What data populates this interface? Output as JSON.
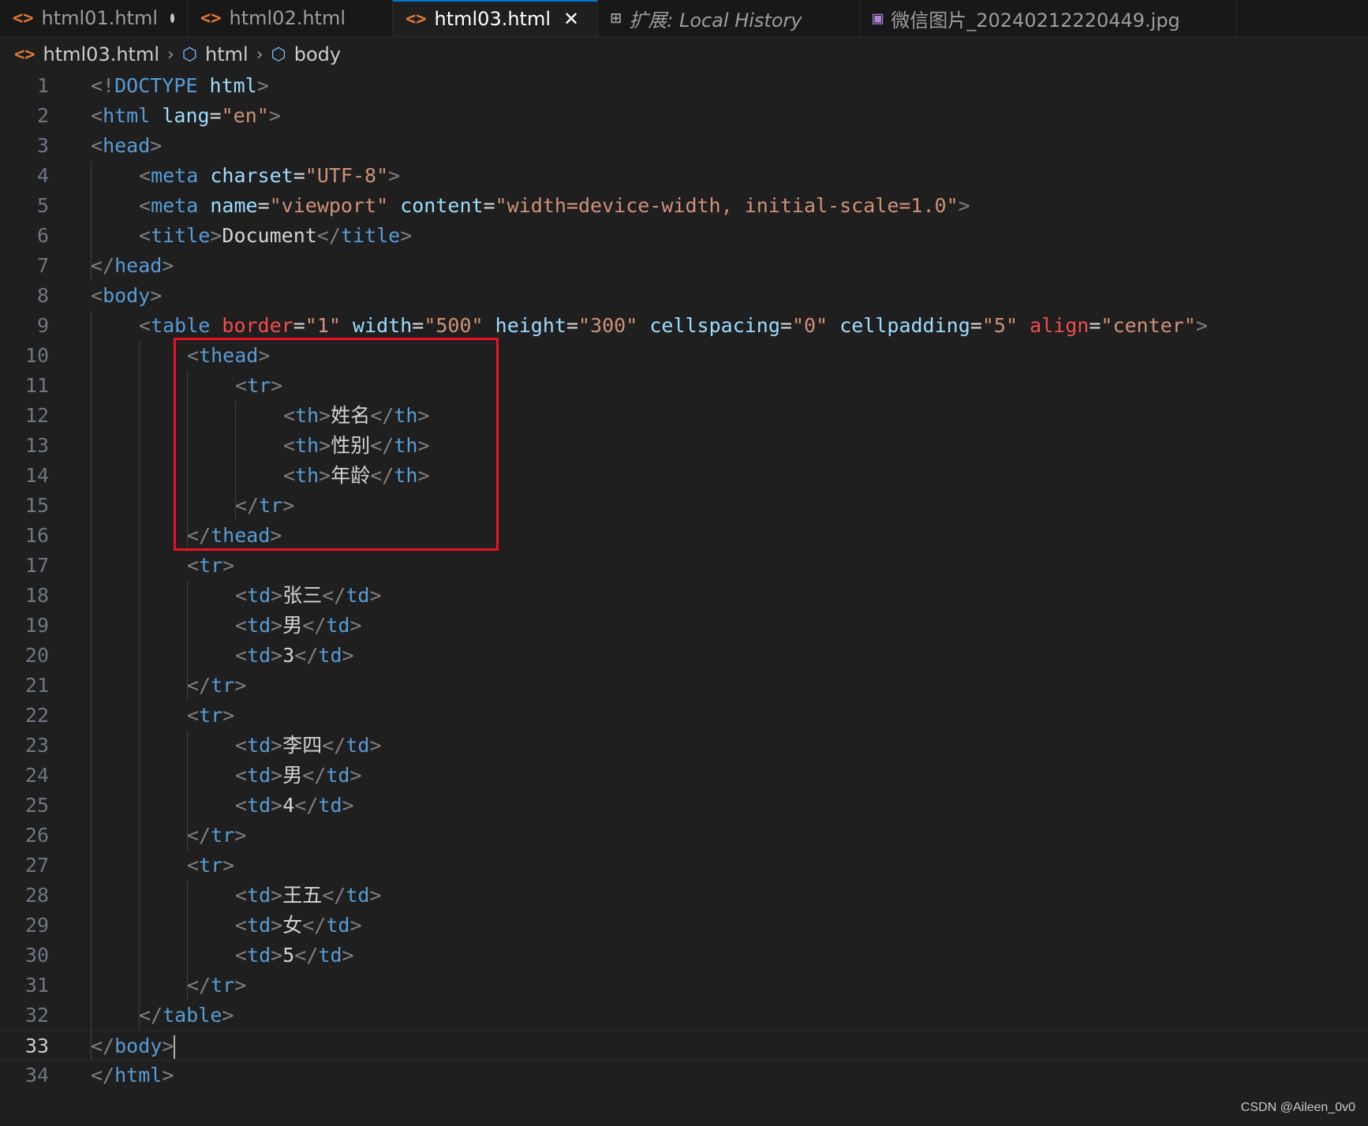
{
  "tabs": [
    {
      "icon": "<>",
      "label": "html01.html",
      "state": "modified"
    },
    {
      "icon": "<>",
      "label": "html02.html",
      "state": "normal"
    },
    {
      "icon": "<>",
      "label": "html03.html",
      "state": "active"
    },
    {
      "icon": "extensions",
      "label": "扩展: Local History",
      "state": "italic"
    },
    {
      "icon": "image",
      "label": "微信图片_20240212220449.jpg",
      "state": "normal"
    }
  ],
  "breadcrumb": [
    "html03.html",
    "html",
    "body"
  ],
  "code_lines": [
    {
      "n": "1",
      "indent": 0,
      "tokens": [
        [
          "t",
          "<!"
        ],
        [
          "tag",
          "DOCTYPE"
        ],
        [
          "txt",
          " "
        ],
        [
          "attr",
          "html"
        ],
        [
          "t",
          ">"
        ]
      ]
    },
    {
      "n": "2",
      "indent": 0,
      "tokens": [
        [
          "t",
          "<"
        ],
        [
          "tag",
          "html"
        ],
        [
          "txt",
          " "
        ],
        [
          "attr",
          "lang"
        ],
        [
          "txt",
          "="
        ],
        [
          "val",
          "\"en\""
        ],
        [
          "t",
          ">"
        ]
      ]
    },
    {
      "n": "3",
      "indent": 0,
      "tokens": [
        [
          "t",
          "<"
        ],
        [
          "tag",
          "head"
        ],
        [
          "t",
          ">"
        ]
      ]
    },
    {
      "n": "4",
      "indent": 1,
      "tokens": [
        [
          "t",
          "<"
        ],
        [
          "tag",
          "meta"
        ],
        [
          "txt",
          " "
        ],
        [
          "attr",
          "charset"
        ],
        [
          "txt",
          "="
        ],
        [
          "val",
          "\"UTF-8\""
        ],
        [
          "t",
          ">"
        ]
      ]
    },
    {
      "n": "5",
      "indent": 1,
      "tokens": [
        [
          "t",
          "<"
        ],
        [
          "tag",
          "meta"
        ],
        [
          "txt",
          " "
        ],
        [
          "attr",
          "name"
        ],
        [
          "txt",
          "="
        ],
        [
          "val",
          "\"viewport\""
        ],
        [
          "txt",
          " "
        ],
        [
          "attr",
          "content"
        ],
        [
          "txt",
          "="
        ],
        [
          "val",
          "\"width=device-width, initial-scale=1.0\""
        ],
        [
          "t",
          ">"
        ]
      ]
    },
    {
      "n": "6",
      "indent": 1,
      "tokens": [
        [
          "t",
          "<"
        ],
        [
          "tag",
          "title"
        ],
        [
          "t",
          ">"
        ],
        [
          "txt",
          "Document"
        ],
        [
          "t",
          "</"
        ],
        [
          "tag",
          "title"
        ],
        [
          "t",
          ">"
        ]
      ]
    },
    {
      "n": "7",
      "indent": 0,
      "tokens": [
        [
          "t",
          "</"
        ],
        [
          "tag",
          "head"
        ],
        [
          "t",
          ">"
        ]
      ]
    },
    {
      "n": "8",
      "indent": 0,
      "tokens": [
        [
          "t",
          "<"
        ],
        [
          "tag",
          "body"
        ],
        [
          "t",
          ">"
        ]
      ]
    },
    {
      "n": "9",
      "indent": 1,
      "tokens": [
        [
          "t",
          "<"
        ],
        [
          "tag",
          "table"
        ],
        [
          "txt",
          " "
        ],
        [
          "warn",
          "border"
        ],
        [
          "txt",
          "="
        ],
        [
          "val",
          "\"1\""
        ],
        [
          "txt",
          " "
        ],
        [
          "attr",
          "width"
        ],
        [
          "txt",
          "="
        ],
        [
          "val",
          "\"500\""
        ],
        [
          "txt",
          " "
        ],
        [
          "attr",
          "height"
        ],
        [
          "txt",
          "="
        ],
        [
          "val",
          "\"300\""
        ],
        [
          "txt",
          " "
        ],
        [
          "attr",
          "cellspacing"
        ],
        [
          "txt",
          "="
        ],
        [
          "val",
          "\"0\""
        ],
        [
          "txt",
          " "
        ],
        [
          "attr",
          "cellpadding"
        ],
        [
          "txt",
          "="
        ],
        [
          "val",
          "\"5\""
        ],
        [
          "txt",
          " "
        ],
        [
          "warn",
          "align"
        ],
        [
          "txt",
          "="
        ],
        [
          "val",
          "\"center\""
        ],
        [
          "t",
          ">"
        ]
      ]
    },
    {
      "n": "10",
      "indent": 2,
      "tokens": [
        [
          "t",
          "<"
        ],
        [
          "tag",
          "thead"
        ],
        [
          "t",
          ">"
        ]
      ]
    },
    {
      "n": "11",
      "indent": 3,
      "tokens": [
        [
          "t",
          "<"
        ],
        [
          "tag",
          "tr"
        ],
        [
          "t",
          ">"
        ]
      ]
    },
    {
      "n": "12",
      "indent": 4,
      "tokens": [
        [
          "t",
          "<"
        ],
        [
          "tag",
          "th"
        ],
        [
          "t",
          ">"
        ],
        [
          "txt",
          "姓名"
        ],
        [
          "t",
          "</"
        ],
        [
          "tag",
          "th"
        ],
        [
          "t",
          ">"
        ]
      ]
    },
    {
      "n": "13",
      "indent": 4,
      "tokens": [
        [
          "t",
          "<"
        ],
        [
          "tag",
          "th"
        ],
        [
          "t",
          ">"
        ],
        [
          "txt",
          "性别"
        ],
        [
          "t",
          "</"
        ],
        [
          "tag",
          "th"
        ],
        [
          "t",
          ">"
        ]
      ]
    },
    {
      "n": "14",
      "indent": 4,
      "tokens": [
        [
          "t",
          "<"
        ],
        [
          "tag",
          "th"
        ],
        [
          "t",
          ">"
        ],
        [
          "txt",
          "年龄"
        ],
        [
          "t",
          "</"
        ],
        [
          "tag",
          "th"
        ],
        [
          "t",
          ">"
        ]
      ]
    },
    {
      "n": "15",
      "indent": 3,
      "tokens": [
        [
          "t",
          "</"
        ],
        [
          "tag",
          "tr"
        ],
        [
          "t",
          ">"
        ]
      ]
    },
    {
      "n": "16",
      "indent": 2,
      "tokens": [
        [
          "t",
          "</"
        ],
        [
          "tag",
          "thead"
        ],
        [
          "t",
          ">"
        ]
      ]
    },
    {
      "n": "17",
      "indent": 2,
      "tokens": [
        [
          "t",
          "<"
        ],
        [
          "tag",
          "tr"
        ],
        [
          "t",
          ">"
        ]
      ]
    },
    {
      "n": "18",
      "indent": 3,
      "tokens": [
        [
          "t",
          "<"
        ],
        [
          "tag",
          "td"
        ],
        [
          "t",
          ">"
        ],
        [
          "txt",
          "张三"
        ],
        [
          "t",
          "</"
        ],
        [
          "tag",
          "td"
        ],
        [
          "t",
          ">"
        ]
      ]
    },
    {
      "n": "19",
      "indent": 3,
      "tokens": [
        [
          "t",
          "<"
        ],
        [
          "tag",
          "td"
        ],
        [
          "t",
          ">"
        ],
        [
          "txt",
          "男"
        ],
        [
          "t",
          "</"
        ],
        [
          "tag",
          "td"
        ],
        [
          "t",
          ">"
        ]
      ]
    },
    {
      "n": "20",
      "indent": 3,
      "tokens": [
        [
          "t",
          "<"
        ],
        [
          "tag",
          "td"
        ],
        [
          "t",
          ">"
        ],
        [
          "txt",
          "3"
        ],
        [
          "t",
          "</"
        ],
        [
          "tag",
          "td"
        ],
        [
          "t",
          ">"
        ]
      ]
    },
    {
      "n": "21",
      "indent": 2,
      "tokens": [
        [
          "t",
          "</"
        ],
        [
          "tag",
          "tr"
        ],
        [
          "t",
          ">"
        ]
      ]
    },
    {
      "n": "22",
      "indent": 2,
      "tokens": [
        [
          "t",
          "<"
        ],
        [
          "tag",
          "tr"
        ],
        [
          "t",
          ">"
        ]
      ]
    },
    {
      "n": "23",
      "indent": 3,
      "tokens": [
        [
          "t",
          "<"
        ],
        [
          "tag",
          "td"
        ],
        [
          "t",
          ">"
        ],
        [
          "txt",
          "李四"
        ],
        [
          "t",
          "</"
        ],
        [
          "tag",
          "td"
        ],
        [
          "t",
          ">"
        ]
      ]
    },
    {
      "n": "24",
      "indent": 3,
      "tokens": [
        [
          "t",
          "<"
        ],
        [
          "tag",
          "td"
        ],
        [
          "t",
          ">"
        ],
        [
          "txt",
          "男"
        ],
        [
          "t",
          "</"
        ],
        [
          "tag",
          "td"
        ],
        [
          "t",
          ">"
        ]
      ]
    },
    {
      "n": "25",
      "indent": 3,
      "tokens": [
        [
          "t",
          "<"
        ],
        [
          "tag",
          "td"
        ],
        [
          "t",
          ">"
        ],
        [
          "txt",
          "4"
        ],
        [
          "t",
          "</"
        ],
        [
          "tag",
          "td"
        ],
        [
          "t",
          ">"
        ]
      ]
    },
    {
      "n": "26",
      "indent": 2,
      "tokens": [
        [
          "t",
          "</"
        ],
        [
          "tag",
          "tr"
        ],
        [
          "t",
          ">"
        ]
      ]
    },
    {
      "n": "27",
      "indent": 2,
      "tokens": [
        [
          "t",
          "<"
        ],
        [
          "tag",
          "tr"
        ],
        [
          "t",
          ">"
        ]
      ]
    },
    {
      "n": "28",
      "indent": 3,
      "tokens": [
        [
          "t",
          "<"
        ],
        [
          "tag",
          "td"
        ],
        [
          "t",
          ">"
        ],
        [
          "txt",
          "王五"
        ],
        [
          "t",
          "</"
        ],
        [
          "tag",
          "td"
        ],
        [
          "t",
          ">"
        ]
      ]
    },
    {
      "n": "29",
      "indent": 3,
      "tokens": [
        [
          "t",
          "<"
        ],
        [
          "tag",
          "td"
        ],
        [
          "t",
          ">"
        ],
        [
          "txt",
          "女"
        ],
        [
          "t",
          "</"
        ],
        [
          "tag",
          "td"
        ],
        [
          "t",
          ">"
        ]
      ]
    },
    {
      "n": "30",
      "indent": 3,
      "tokens": [
        [
          "t",
          "<"
        ],
        [
          "tag",
          "td"
        ],
        [
          "t",
          ">"
        ],
        [
          "txt",
          "5"
        ],
        [
          "t",
          "</"
        ],
        [
          "tag",
          "td"
        ],
        [
          "t",
          ">"
        ]
      ]
    },
    {
      "n": "31",
      "indent": 2,
      "tokens": [
        [
          "t",
          "</"
        ],
        [
          "tag",
          "tr"
        ],
        [
          "t",
          ">"
        ]
      ]
    },
    {
      "n": "32",
      "indent": 1,
      "tokens": [
        [
          "t",
          "</"
        ],
        [
          "tag",
          "table"
        ],
        [
          "t",
          ">"
        ]
      ]
    },
    {
      "n": "33",
      "indent": 0,
      "current": true,
      "tokens": [
        [
          "t",
          "</"
        ],
        [
          "tag",
          "body"
        ],
        [
          "t",
          ">"
        ]
      ]
    },
    {
      "n": "34",
      "indent": 0,
      "tokens": [
        [
          "t",
          "</"
        ],
        [
          "tag",
          "html"
        ],
        [
          "t",
          ">"
        ]
      ]
    }
  ],
  "watermark": "CSDN @Aileen_0v0"
}
